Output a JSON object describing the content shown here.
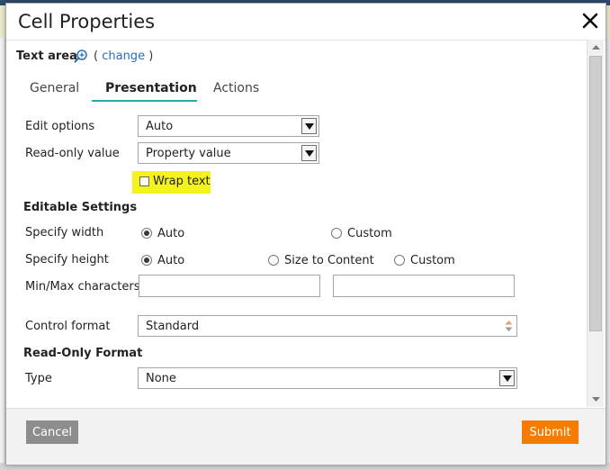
{
  "dialog": {
    "title": "Cell Properties",
    "control_name": "Text area",
    "change_open": "(",
    "change_link": "change",
    "change_close": ")"
  },
  "tabs": [
    {
      "label": "General",
      "active": false
    },
    {
      "label": "Presentation",
      "active": true
    },
    {
      "label": "Actions",
      "active": false
    }
  ],
  "presentation": {
    "edit_options_label": "Edit options",
    "edit_options_value": "Auto",
    "readonly_value_label": "Read-only value",
    "readonly_value_value": "Property value",
    "wrap_text_label": "Wrap text",
    "wrap_text_checked": false,
    "editable_section": "Editable Settings",
    "width_label": "Specify width",
    "width_options": [
      "Auto",
      "Custom"
    ],
    "width_selected": "Auto",
    "height_label": "Specify height",
    "height_options": [
      "Auto",
      "Size to Content",
      "Custom"
    ],
    "height_selected": "Auto",
    "minmax_label": "Min/Max characters",
    "min_value": "",
    "max_value": "",
    "control_format_label": "Control format",
    "control_format_value": "Standard",
    "readonly_section": "Read-Only Format",
    "type_label": "Type",
    "type_value": "None"
  },
  "footer": {
    "cancel_label": "Cancel",
    "submit_label": "Submit"
  },
  "colors": {
    "accent_tab": "#2aa7a7",
    "submit": "#f57c00",
    "cancel": "#8d8d8d",
    "highlight": "#f5f31f",
    "link": "#2a6db5"
  }
}
